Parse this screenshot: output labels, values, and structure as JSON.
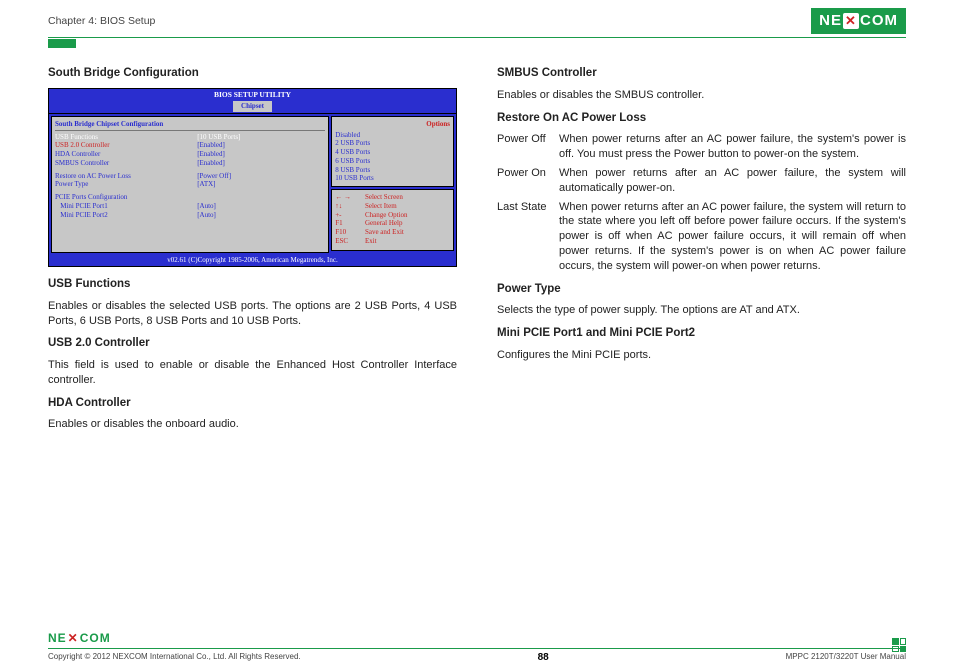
{
  "header": {
    "chapter": "Chapter 4: BIOS Setup",
    "brand": "NEXCOM"
  },
  "left": {
    "title": "South Bridge Configuration",
    "usb_func_h": "USB Functions",
    "usb_func_p": "Enables or disables the selected USB ports. The options are 2 USB Ports, 4 USB Ports, 6 USB Ports, 8 USB Ports and 10 USB Ports.",
    "usb20_h": "USB 2.0 Controller",
    "usb20_p": "This field is used to enable or disable the Enhanced Host Controller Interface controller.",
    "hda_h": "HDA Controller",
    "hda_p": "Enables or disables the onboard audio."
  },
  "bios": {
    "title": "BIOS SETUP UTILITY",
    "tab": "Chipset",
    "subtitle": "South Bridge Chipset Configuration",
    "rows": {
      "r1k": "USB Functions",
      "r1v": "[10 USB Ports]",
      "r2k": "USB 2.0 Controller",
      "r2v": "[Enabled]",
      "r3k": "HDA Controller",
      "r3v": "[Enabled]",
      "r4k": "SMBUS Controller",
      "r4v": "[Enabled]",
      "r5k": "Restore on AC Power Loss",
      "r5v": "[Power Off]",
      "r6k": "Power Type",
      "r6v": "[ATX]",
      "r7k": "PCIE Ports Configuration",
      "r8k": "   Mini PCIE Port1",
      "r8v": "[Auto]",
      "r9k": "   Mini PCIE Port2",
      "r9v": "[Auto]"
    },
    "options_title": "Options",
    "options": {
      "o1": "Disabled",
      "o2": "2 USB Ports",
      "o3": "4 USB Ports",
      "o4": "6 USB Ports",
      "o5": "8 USB Ports",
      "o6": "10 USB Ports"
    },
    "keys": {
      "k1a": "← →",
      "k1b": "Select Screen",
      "k2a": "↑↓",
      "k2b": "Select Item",
      "k3a": "+-",
      "k3b": "Change Option",
      "k4a": "F1",
      "k4b": "General Help",
      "k5a": "F10",
      "k5b": "Save and Exit",
      "k6a": "ESC",
      "k6b": "Exit"
    },
    "footer": "v02.61 (C)Copyright 1985-2006, American Megatrends, Inc."
  },
  "right": {
    "smbus_h": "SMBUS Controller",
    "smbus_p": "Enables or disables the SMBUS controller.",
    "restore_h": "Restore On AC Power Loss",
    "d1t": "Power Off",
    "d1d": "When power returns after an AC power failure, the system's power is off. You must press the Power button to power-on the system.",
    "d2t": "Power On",
    "d2d": "When power returns after an AC power failure, the system will automatically power-on.",
    "d3t": "Last State",
    "d3d": "When power returns after an AC power failure, the system will return to the state where you left off before power failure occurs. If the system's power is off when AC power failure occurs, it will remain off when power returns. If the system's power is on when AC power failure occurs, the system will power-on when power returns.",
    "ptype_h": "Power Type",
    "ptype_p": "Selects the type of power supply. The options are AT and ATX.",
    "pcie_h": "Mini PCIE Port1 and Mini PCIE Port2",
    "pcie_p": "Configures the Mini PCIE ports."
  },
  "footer": {
    "copyright": "Copyright © 2012 NEXCOM International Co., Ltd. All Rights Reserved.",
    "page": "88",
    "manual": "MPPC 2120T/3220T User Manual"
  }
}
